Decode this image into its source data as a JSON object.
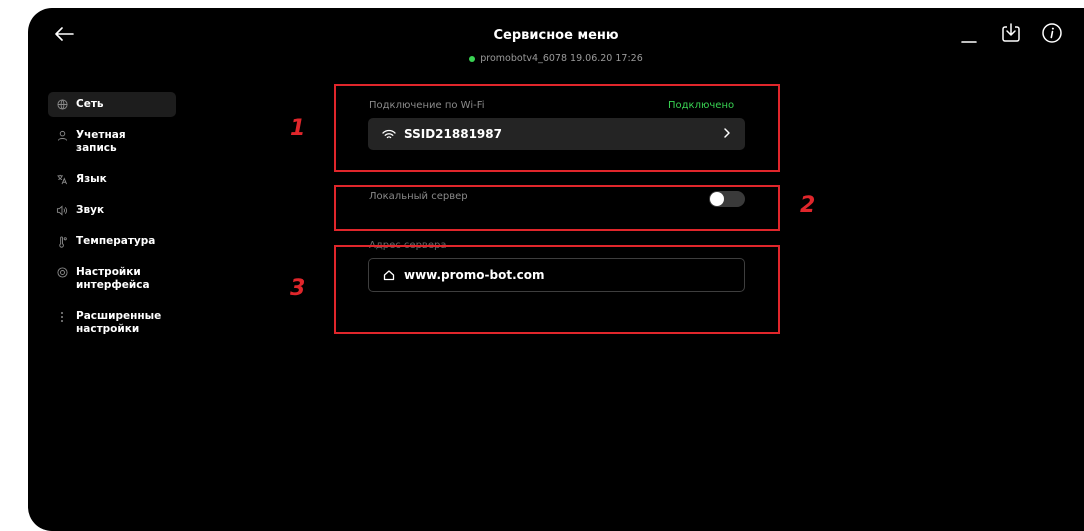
{
  "header": {
    "title": "Сервисное меню",
    "device_status": "promobotv4_6078 19.06.20 17:26",
    "status_color": "#39d353"
  },
  "sidebar": {
    "items": [
      {
        "icon": "globe-icon",
        "label": "Сеть",
        "active": true
      },
      {
        "icon": "user-icon",
        "label": "Учетная запись"
      },
      {
        "icon": "translate-icon",
        "label": "Язык"
      },
      {
        "icon": "speaker-icon",
        "label": "Звук"
      },
      {
        "icon": "thermometer-icon",
        "label": "Температура"
      },
      {
        "icon": "settings-circle-icon",
        "label": "Настройки\nинтерфейса"
      },
      {
        "icon": "more-vertical-icon",
        "label": "Расширенные\nнастройки"
      }
    ]
  },
  "wifi": {
    "label": "Подключение по Wi-Fi",
    "status": "Подключено",
    "ssid": "SSID21881987"
  },
  "local_server": {
    "label": "Локальный сервер",
    "enabled": false
  },
  "server_address": {
    "label": "Адрес сервера",
    "value": "www.promo-bot.com"
  },
  "annotations": [
    "1",
    "2",
    "3"
  ],
  "colors": {
    "accent_green": "#39d353",
    "annotation_red": "#e0262b",
    "background": "#000000"
  }
}
